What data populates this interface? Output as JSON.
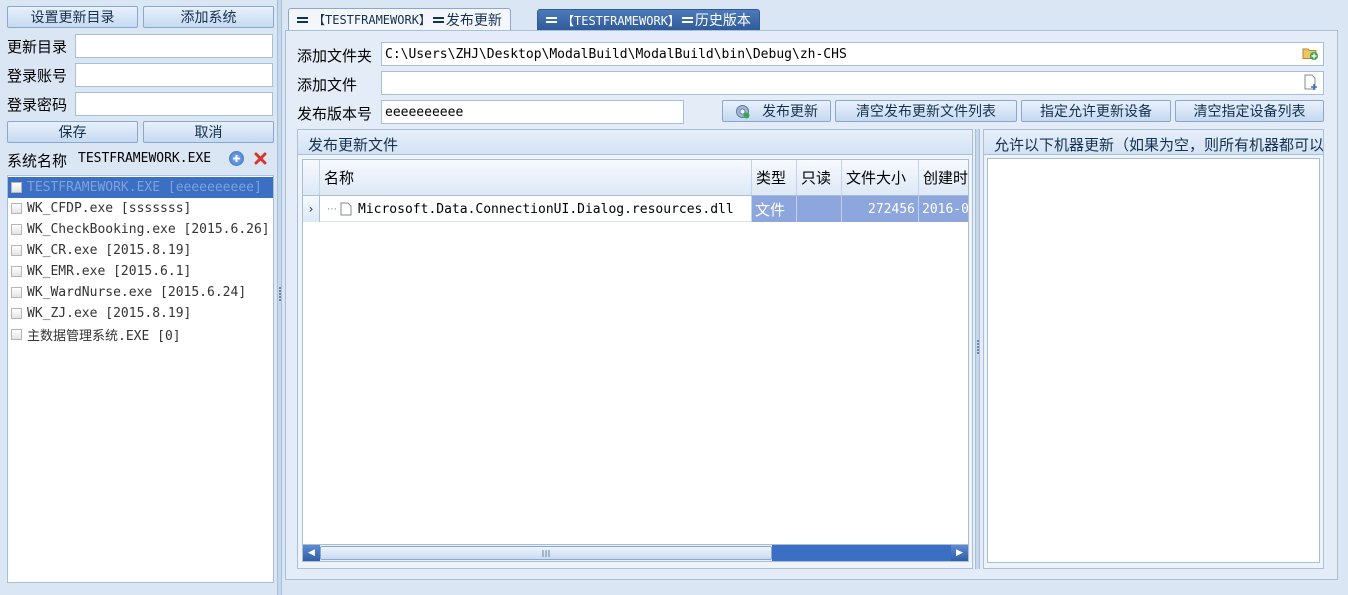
{
  "left": {
    "set_dir_button": "设置更新目录",
    "add_system_button": "添加系统",
    "update_dir_label": "更新目录",
    "update_dir_value": "",
    "account_label": "登录账号",
    "account_value": "",
    "password_label": "登录密码",
    "password_value": "",
    "save_button": "保存",
    "cancel_button": "取消",
    "system_name_label": "系统名称",
    "system_name_value": "TESTFRAMEWORK.EXE",
    "systems": [
      {
        "label": "TESTFRAMEWORK.EXE [eeeeeeeeee]",
        "selected": true
      },
      {
        "label": "WK_CFDP.exe [sssssss]",
        "selected": false
      },
      {
        "label": "WK_CheckBooking.exe [2015.6.26]",
        "selected": false
      },
      {
        "label": "WK_CR.exe [2015.8.19]",
        "selected": false
      },
      {
        "label": "WK_EMR.exe [2015.6.1]",
        "selected": false
      },
      {
        "label": "WK_WardNurse.exe [2015.6.24]",
        "selected": false
      },
      {
        "label": "WK_ZJ.exe [2015.8.19]",
        "selected": false
      },
      {
        "label": "主数据管理系统.EXE [0]",
        "selected": false
      }
    ]
  },
  "tabs": [
    {
      "label": "【TESTFRAMEWORK】",
      "suffix": "发布更新",
      "active": true
    },
    {
      "label": "【TESTFRAMEWORK】",
      "suffix": "历史版本",
      "active": false
    }
  ],
  "publish": {
    "add_folder_label": "添加文件夹",
    "add_folder_value": "C:\\Users\\ZHJ\\Desktop\\ModalBuild\\ModalBuild\\bin\\Debug\\zh-CHS",
    "add_file_label": "添加文件",
    "add_file_value": "",
    "version_label": "发布版本号",
    "version_value": "eeeeeeeeee",
    "publish_button": "发布更新",
    "clear_files_button": "清空发布更新文件列表",
    "specify_devices_button": "指定允许更新设备",
    "clear_devices_button": "清空指定设备列表"
  },
  "files_panel": {
    "title": "发布更新文件",
    "columns": [
      "名称",
      "类型",
      "只读",
      "文件大小",
      "创建时间"
    ],
    "rows": [
      {
        "name": "Microsoft.Data.ConnectionUI.Dialog.resources.dll",
        "type": "文件",
        "readonly": "",
        "size": "272456",
        "created": "2016-0"
      }
    ]
  },
  "devices_panel": {
    "title": "允许以下机器更新（如果为空，则所有机器都可以更新）"
  },
  "colors": {
    "background": "#dbe6f4",
    "selected_row": "#3a6fc4",
    "grid_highlight": "#8da7de",
    "button_text": "#15314f"
  }
}
